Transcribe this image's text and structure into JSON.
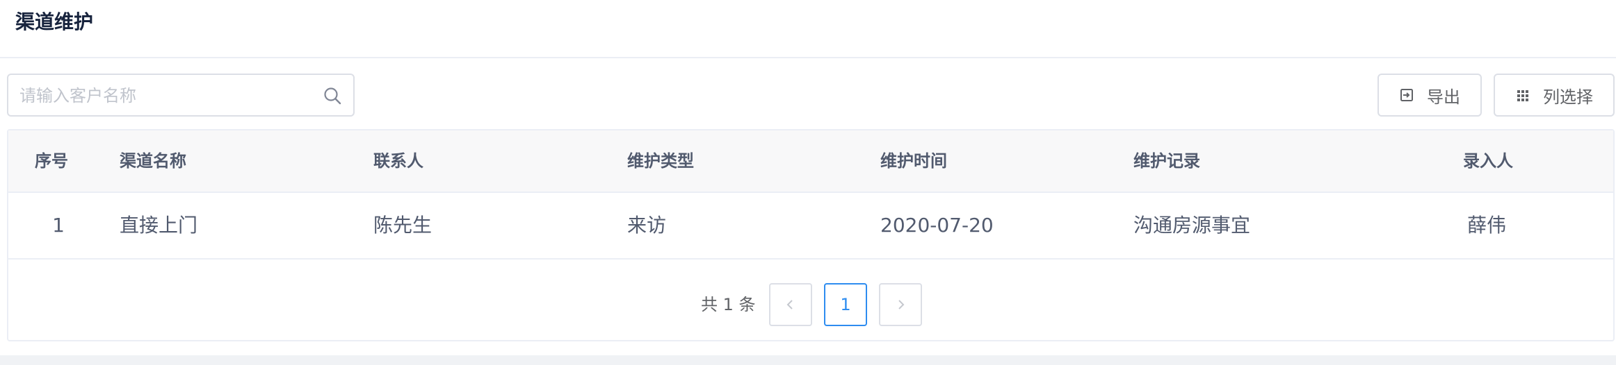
{
  "header": {
    "title": "渠道维护"
  },
  "search": {
    "placeholder": "请输入客户名称",
    "value": ""
  },
  "toolbar": {
    "export_label": "导出",
    "columns_label": "列选择"
  },
  "table": {
    "columns": [
      "序号",
      "渠道名称",
      "联系人",
      "维护类型",
      "维护时间",
      "维护记录",
      "录入人"
    ],
    "rows": [
      [
        "1",
        "直接上门",
        "陈先生",
        "来访",
        "2020-07-20",
        "沟通房源事宜",
        "薛伟"
      ]
    ]
  },
  "pagination": {
    "total_text": "共 1 条",
    "current_page": "1"
  },
  "colors": {
    "primary": "#2d8cf0",
    "border": "#dcdfe6",
    "header_bg": "#f8f8f9"
  }
}
